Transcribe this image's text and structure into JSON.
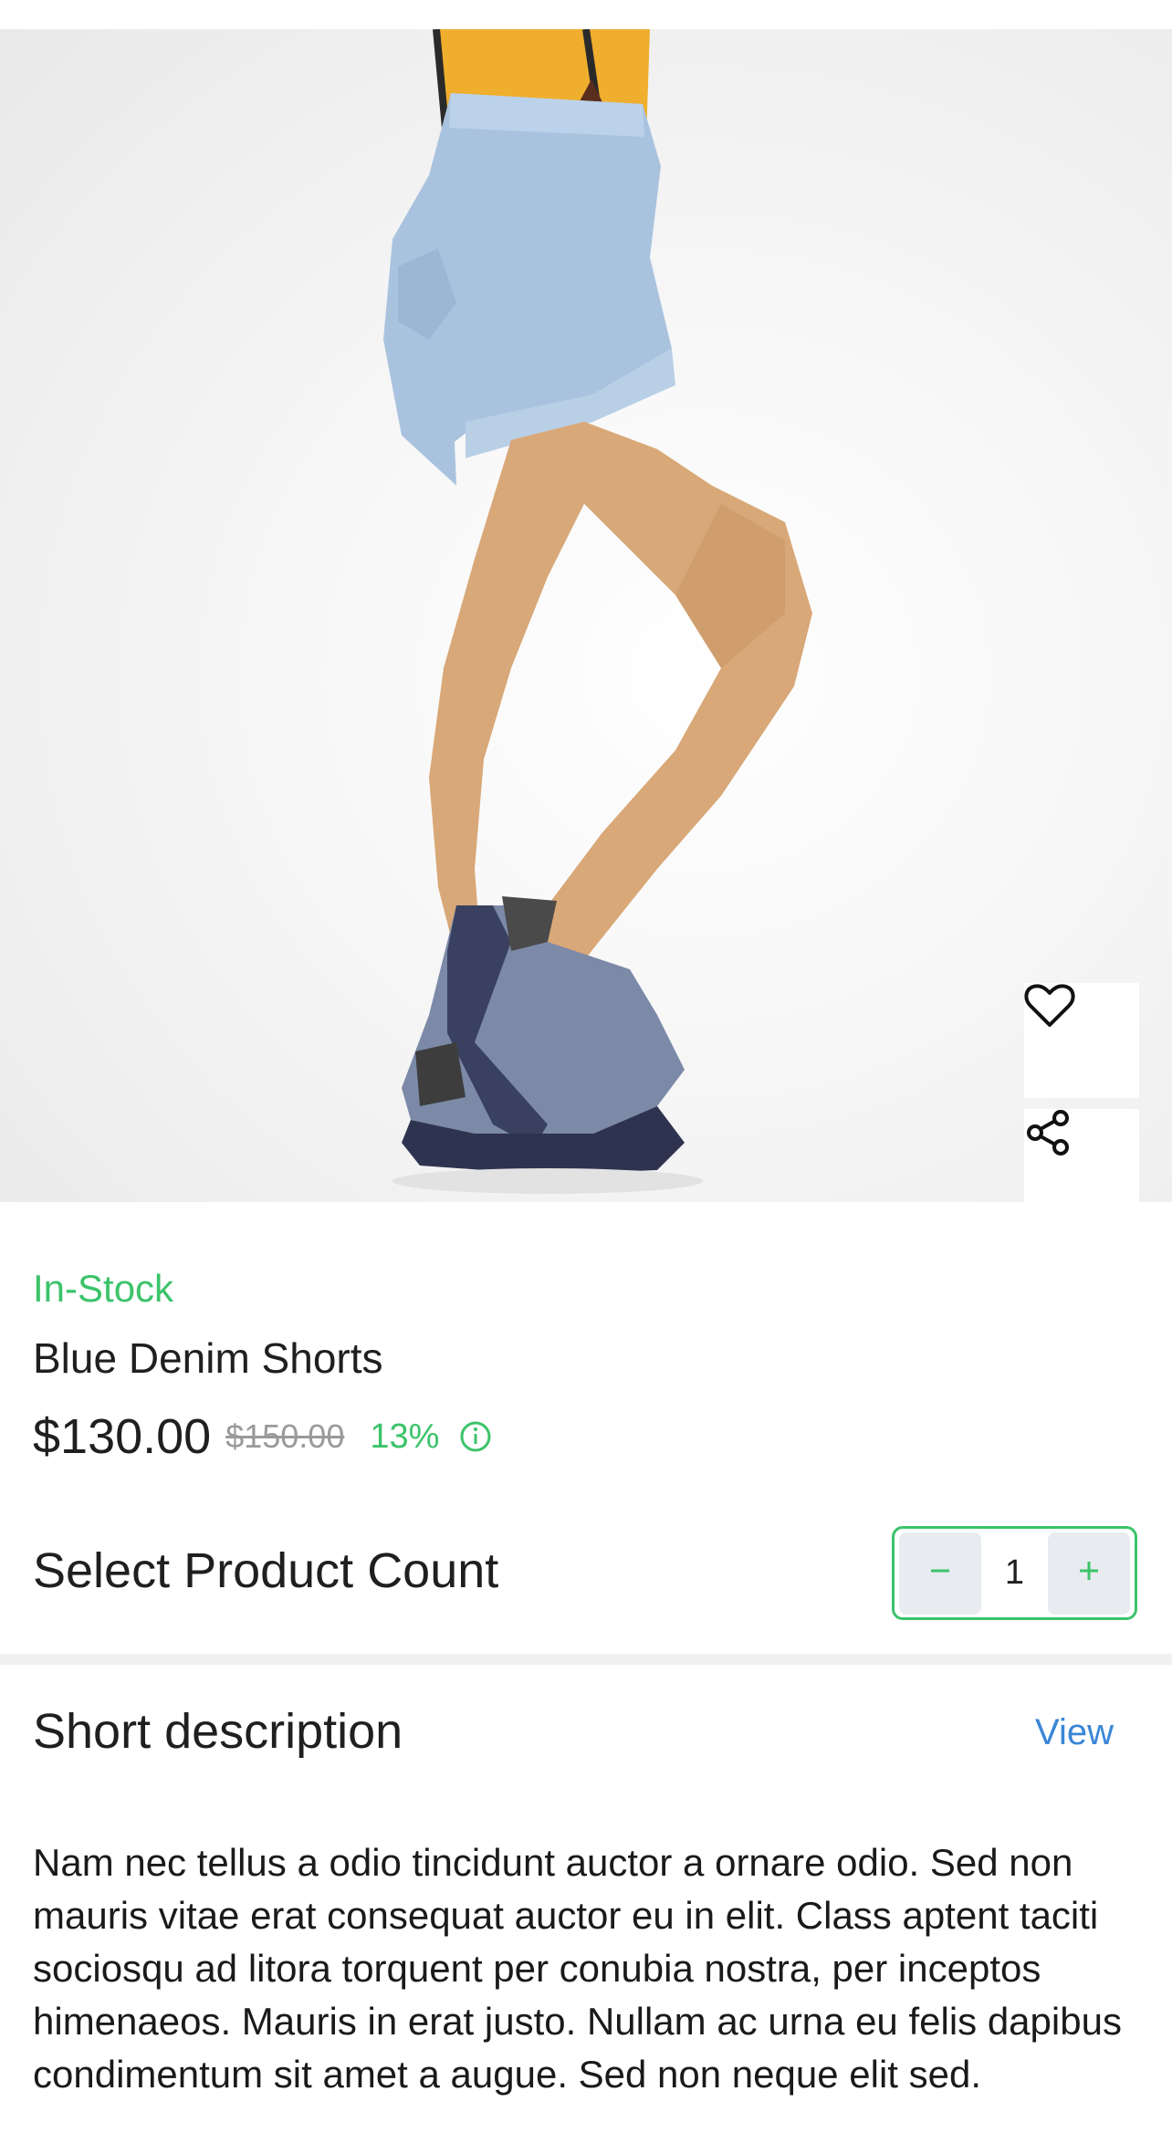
{
  "product": {
    "stock_status": "In-Stock",
    "name": "Blue Denim Shorts",
    "price": "$130.00",
    "original_price": "$150.00",
    "discount": "13%"
  },
  "quantity": {
    "label": "Select Product Count",
    "value": "1",
    "decrement_icon": "minus-icon",
    "increment_icon": "plus-icon"
  },
  "actions": {
    "wishlist_icon": "heart-icon",
    "share_icon": "share-icon",
    "info_icon": "info-icon"
  },
  "short_description": {
    "heading": "Short description",
    "view_label": "View",
    "text": "Nam nec tellus a odio tincidunt auctor a ornare odio. Sed non mauris vitae erat consequat auctor eu in elit. Class aptent taciti sociosqu ad litora torquent per conubia nostra, per inceptos himenaeos. Mauris in erat justo. Nullam ac urna eu felis dapibus condimentum sit amet a augue. Sed non neque elit sed."
  },
  "colors": {
    "accent_green": "#3cc36a",
    "link_blue": "#3a86d6"
  }
}
